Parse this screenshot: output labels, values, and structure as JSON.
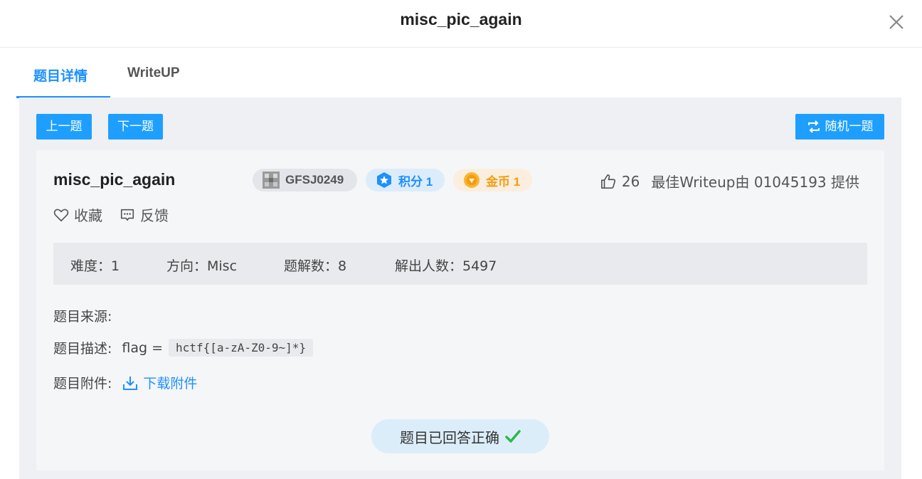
{
  "modal": {
    "title": "misc_pic_again",
    "close_icon": "close-icon"
  },
  "tabs": [
    {
      "label": "题目详情",
      "active": true
    },
    {
      "label": "WriteUP",
      "active": false
    }
  ],
  "nav": {
    "prev_label": "上一题",
    "next_label": "下一题",
    "random_label": "随机一题",
    "random_icon": "shuffle-icon"
  },
  "challenge": {
    "title": "misc_pic_again",
    "id_tag": "GFSJ0249",
    "score_tag": "积分 1",
    "coin_tag": "金币 1",
    "likes": "26",
    "writeup_credit": "最佳Writeup由 01045193 提供",
    "favorite_label": "收藏",
    "feedback_label": "反馈"
  },
  "stats": {
    "difficulty": "难度：1",
    "category": "方向：Misc",
    "writeups": "题解数：8",
    "solvers": "解出人数：5497"
  },
  "fields": {
    "source_label": "题目来源:",
    "desc_label": "题目描述:",
    "desc_text": "flag =",
    "desc_code": "hctf{[a-zA-Z0-9~]*}",
    "attach_label": "题目附件:",
    "download_label": "下载附件"
  },
  "status": {
    "answered_label": "题目已回答正确",
    "check_icon": "check-icon"
  },
  "colors": {
    "accent": "#1e90ff",
    "button": "#1e9fff",
    "coin": "#f39c12",
    "success": "#2db84d"
  }
}
